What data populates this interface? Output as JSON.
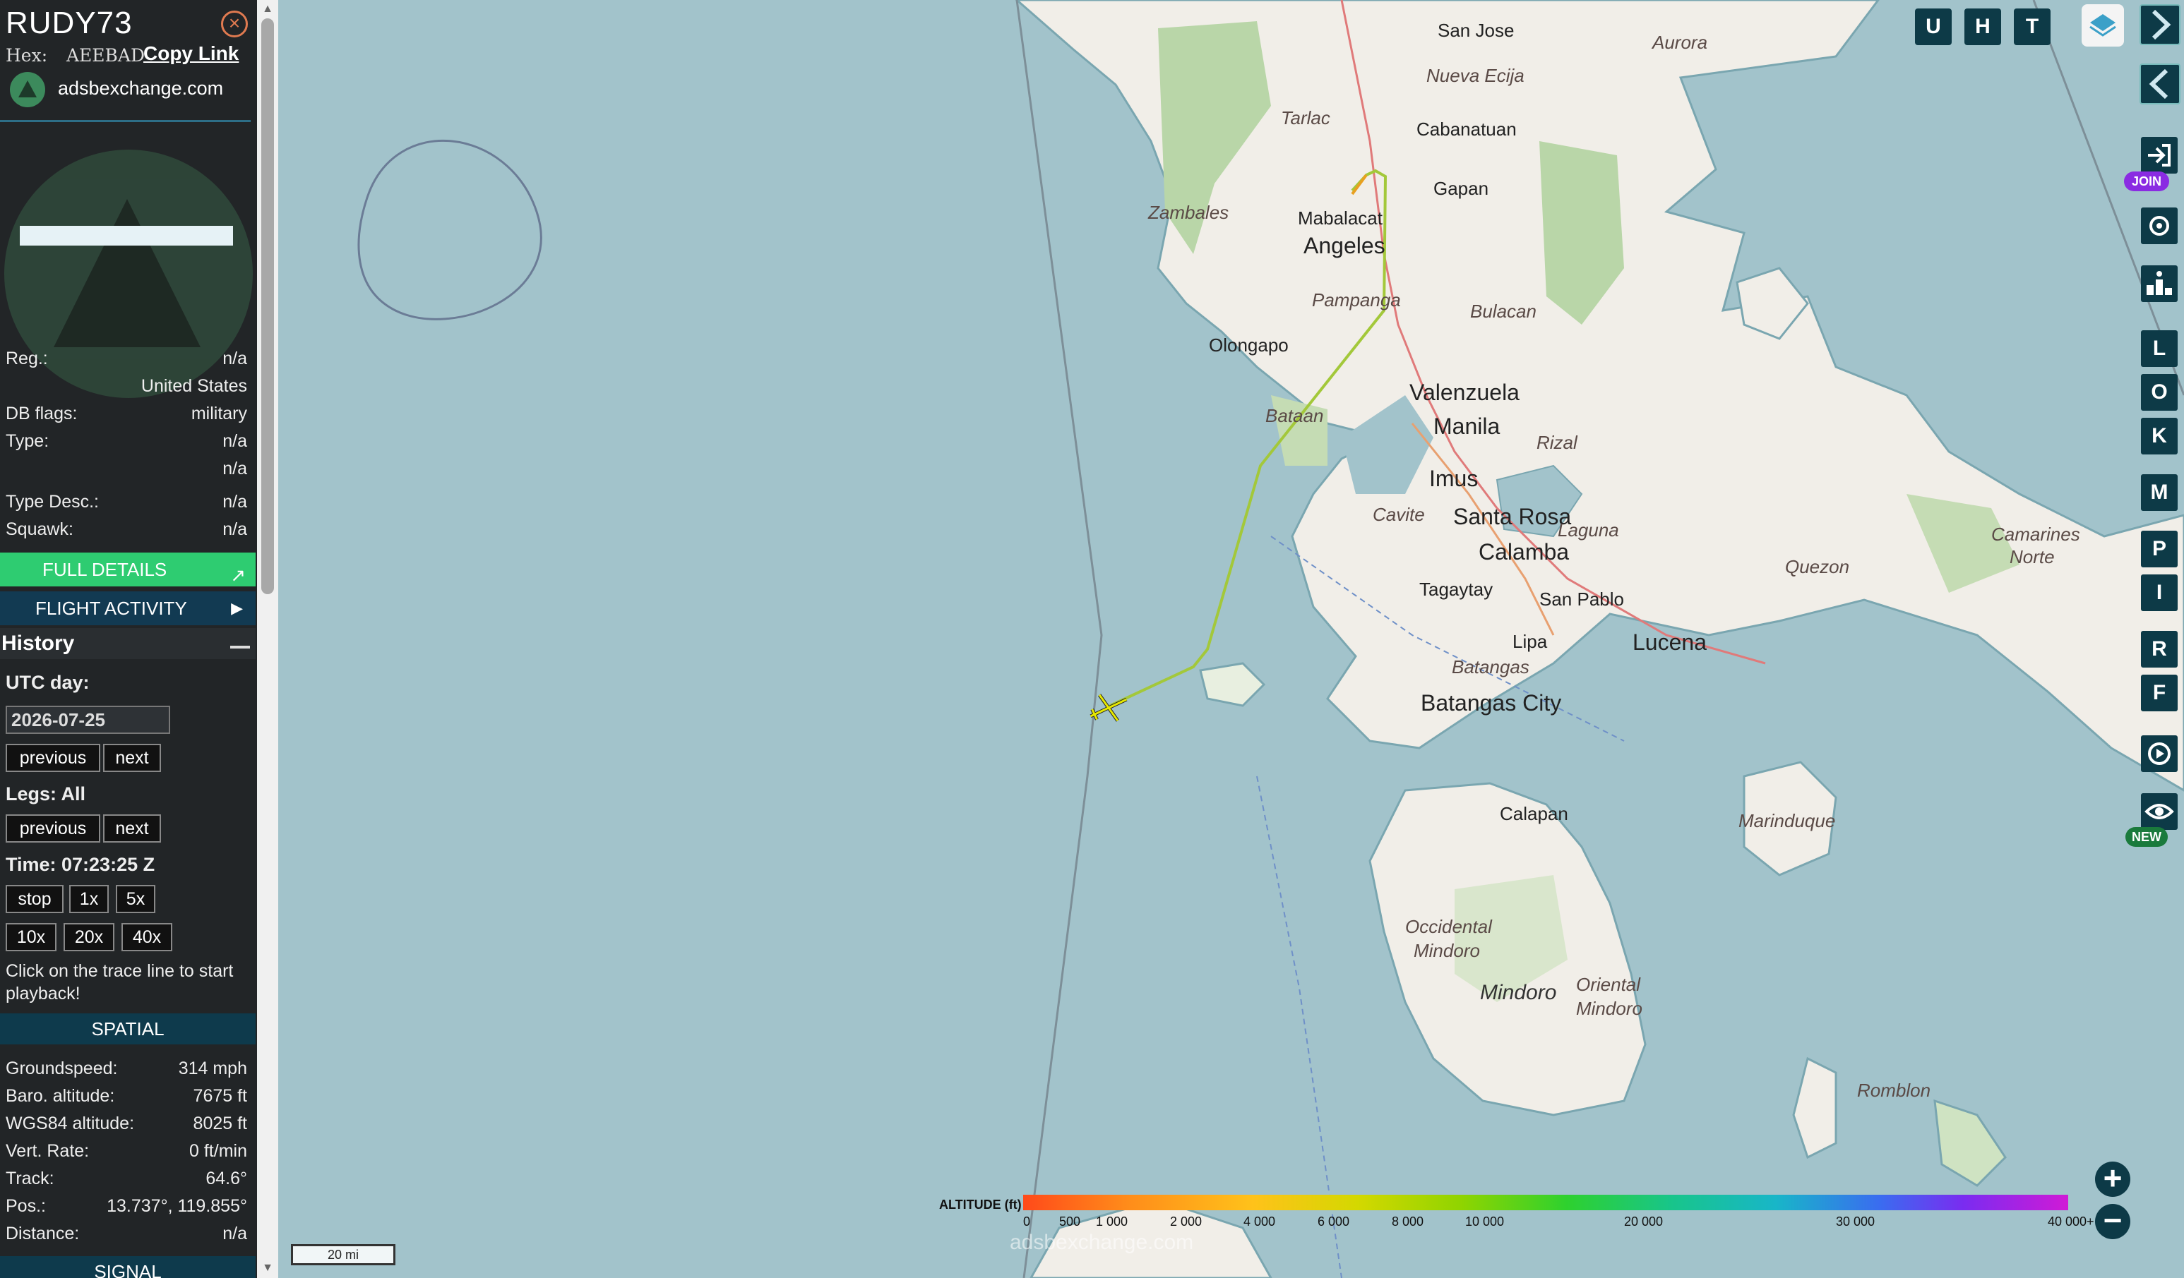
{
  "aircraft": {
    "callsign": "RUDY73",
    "hex_label": "Hex:",
    "hex_value": "AEEBAD",
    "copy_link": "Copy Link",
    "source": "adsbexchange.com",
    "reg_label": "Reg.:",
    "reg_value": "n/a",
    "country": "United States",
    "dbflags_label": "DB flags:",
    "dbflags_value": "military",
    "type_label": "Type:",
    "type_value": "n/a",
    "type_value2": "n/a",
    "typedesc_label": "Type Desc.:",
    "typedesc_value": "n/a",
    "squawk_label": "Squawk:",
    "squawk_value": "n/a",
    "full_details": "FULL DETAILS",
    "flight_activity": "FLIGHT ACTIVITY"
  },
  "history": {
    "title": "History",
    "utc_day_label": "UTC day:",
    "date_value": "2026-07-25",
    "previous": "previous",
    "next": "next",
    "legs_label": "Legs: All",
    "time_label": "Time: 07:23:25 Z",
    "speeds": [
      "stop",
      "1x",
      "5x",
      "10x",
      "20x",
      "40x"
    ],
    "hint": "Click on the trace line to start playback!"
  },
  "spatial": {
    "title": "SPATIAL",
    "rows": [
      {
        "label": "Groundspeed:",
        "value": "314 mph"
      },
      {
        "label": "Baro. altitude:",
        "value": "7675 ft"
      },
      {
        "label": "WGS84 altitude:",
        "value": "8025 ft"
      },
      {
        "label": "Vert. Rate:",
        "value": "0 ft/min"
      },
      {
        "label": "Track:",
        "value": "64.6°"
      },
      {
        "label": "Pos.:",
        "value": "13.737°, 119.855°"
      },
      {
        "label": "Distance:",
        "value": "n/a"
      }
    ],
    "next_section": "SIGNAL"
  },
  "toolbar": {
    "u": "U",
    "h": "H",
    "t": "T",
    "join": "JOIN",
    "new": "NEW",
    "letters": [
      "L",
      "O",
      "K",
      "M",
      "P",
      "I",
      "R",
      "F"
    ]
  },
  "legend": {
    "title": "ALTITUDE (ft)",
    "ticks": [
      "0",
      "500",
      "1 000",
      "2 000",
      "4 000",
      "6 000",
      "8 000",
      "10 000",
      "20 000",
      "30 000",
      "40 000+"
    ]
  },
  "map": {
    "scale": "20 mi",
    "watermark": "adsbexchange.com",
    "labels": {
      "san_jose": "San Jose",
      "aurora": "Aurora",
      "nueva_ecija": "Nueva Ecija",
      "tarlac": "Tarlac",
      "cabanatuan": "Cabanatuan",
      "zambales": "Zambales",
      "mabalacat": "Mabalacat",
      "gapan": "Gapan",
      "angeles": "Angeles",
      "pampanga": "Pampanga",
      "bulacan": "Bulacan",
      "olongapo": "Olongapo",
      "valenzuela": "Valenzuela",
      "bataan": "Bataan",
      "manila": "Manila",
      "rizal": "Rizal",
      "imus": "Imus",
      "cavite": "Cavite",
      "santa_rosa": "Santa Rosa",
      "laguna": "Laguna",
      "calamba": "Calamba",
      "quezon": "Quezon",
      "tagaytay": "Tagaytay",
      "san_pablo": "San Pablo",
      "lipa": "Lipa",
      "lucena": "Lucena",
      "batangas": "Batangas",
      "batangas_city": "Batangas City",
      "camarines_norte_1": "Camarines",
      "camarines_norte_2": "Norte",
      "calapan": "Calapan",
      "marinduque": "Marinduque",
      "occ_mindoro_1": "Occidental",
      "occ_mindoro_2": "Mindoro",
      "mindoro": "Mindoro",
      "or_mindoro_1": "Oriental",
      "or_mindoro_2": "Mindoro",
      "romblon": "Romblon"
    }
  }
}
